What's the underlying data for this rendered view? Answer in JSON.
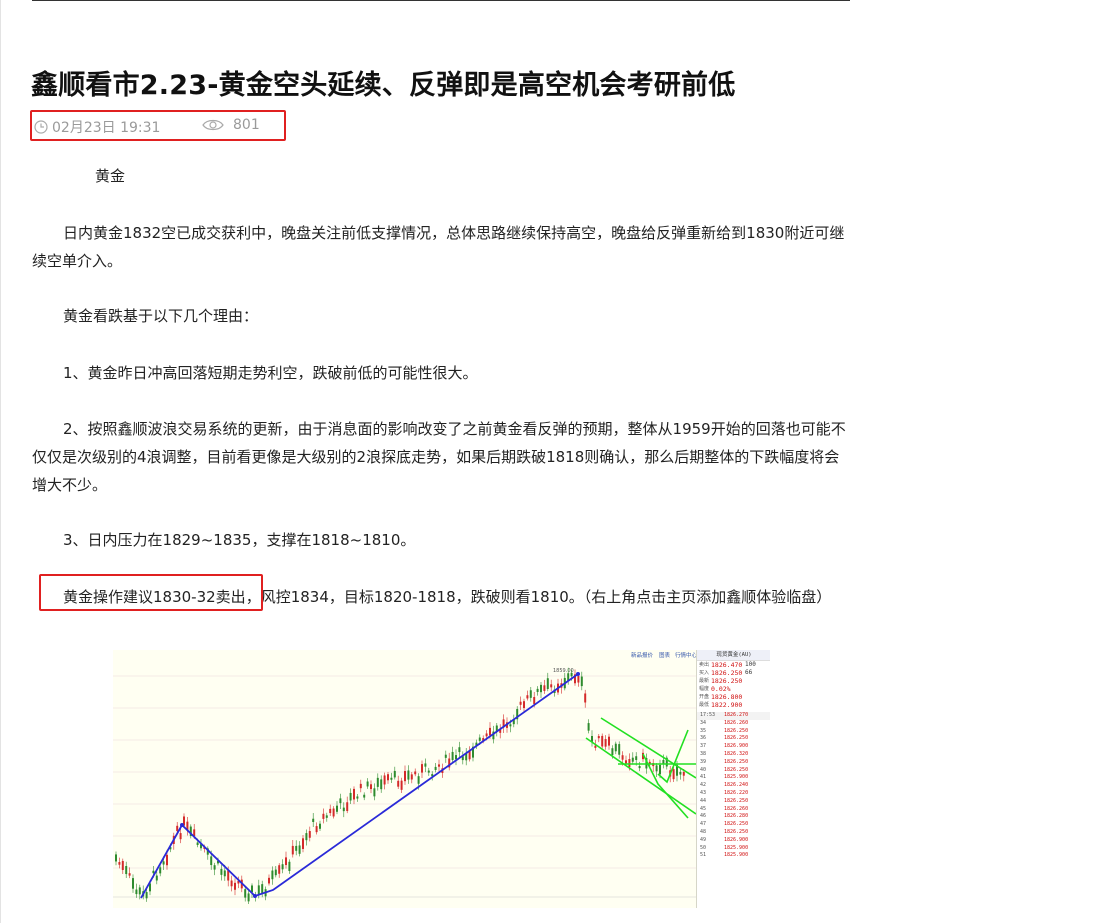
{
  "article": {
    "title": "鑫顺看市2.23-黄金空头延续、反弹即是高空机会考研前低",
    "date": "02月23日 19:31",
    "views": "801",
    "section_title": "黄金",
    "paragraphs": [
      "日内黄金1832空已成交获利中，晚盘关注前低支撑情况，总体思路继续保持高空，晚盘给反弹重新给到1830附近可继续空单介入。",
      "黄金看跌基于以下几个理由：",
      "1、黄金昨日冲高回落短期走势利空，跌破前低的可能性很大。",
      "2、按照鑫顺波浪交易系统的更新，由于消息面的影响改变了之前黄金看反弹的预期，整体从1959开始的回落也可能不仅仅是次级别的4浪调整，目前看更像是大级别的2浪探底走势，如果后期跌破1818则确认，那么后期整体的下跌幅度将会增大不少。",
      "3、日内压力在1829~1835，支撑在1818~1810。"
    ],
    "advice_highlight": "黄金操作建议1830-32卖出",
    "advice_rest": "，风控1834，目标1820-1818，跌破则看1810。（右上角点击主页添加鑫顺体验临盘）"
  },
  "icons": {
    "clock": "clock-icon",
    "views": "eye-icon"
  },
  "colors": {
    "highlight_border": "#e02020",
    "meta_text": "#9a9a9a",
    "trend_line": "#2a2ad8",
    "channel_line": "#22e022"
  },
  "chart": {
    "top_links": [
      "新品报价",
      "图表",
      "行情中心"
    ],
    "peak_label": "1859.00",
    "quote": {
      "title": "现货黄金(AU)",
      "sell_label": "卖出",
      "sell": "1826.470",
      "sell_qty": "100",
      "buy_label": "买入",
      "buy": "1826.250",
      "buy_qty": "66",
      "rows": [
        {
          "k": "最新",
          "v": "1826.250"
        },
        {
          "k": "幅度",
          "v": "0.02%"
        },
        {
          "k": "开盘",
          "v": "1826.800"
        },
        {
          "k": "最低",
          "v": "1822.900"
        }
      ],
      "tick_header": {
        "time": "17:53",
        "price": "1826.270"
      },
      "ticks": [
        "1826.260",
        "1826.250",
        "1826.250",
        "1826.900",
        "1826.320",
        "1826.250",
        "1826.250",
        "1825.900",
        "1826.240",
        "1826.220",
        "1826.250",
        "1826.260",
        "1826.280",
        "1826.250",
        "1826.250",
        "1826.900",
        "1825.900",
        "1825.900"
      ]
    }
  }
}
